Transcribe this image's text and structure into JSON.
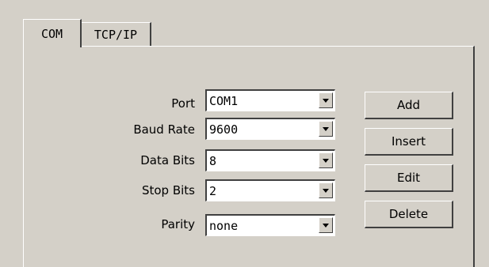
{
  "tabs": [
    {
      "label": "COM",
      "active": true
    },
    {
      "label": "TCP/IP",
      "active": false
    }
  ],
  "fields": [
    {
      "label": "Port",
      "value": "COM1"
    },
    {
      "label": "Baud Rate",
      "value": "9600"
    },
    {
      "label": "Data Bits",
      "value": "8"
    },
    {
      "label": "Stop Bits",
      "value": "2"
    },
    {
      "label": "Parity",
      "value": "none"
    }
  ],
  "buttons": {
    "add": "Add",
    "insert": "Insert",
    "edit": "Edit",
    "delete": "Delete"
  },
  "icons": {
    "dropdown": "chevron-down-icon"
  },
  "colors": {
    "face": "#d4d0c8",
    "highlight": "#ffffff",
    "shadow": "#404040",
    "field": "#ffffff"
  }
}
